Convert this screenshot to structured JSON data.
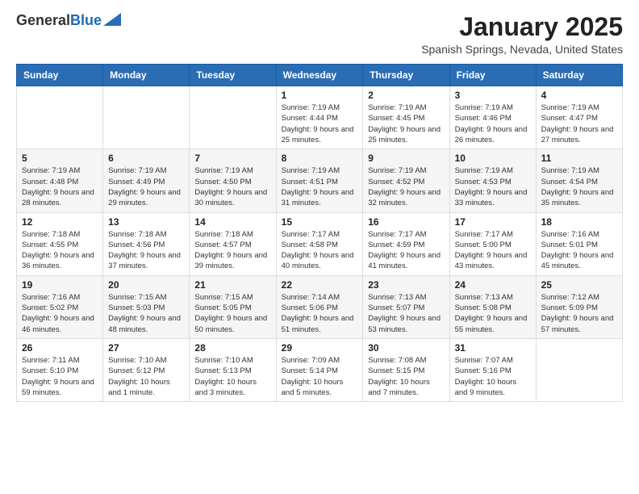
{
  "header": {
    "logo_general": "General",
    "logo_blue": "Blue",
    "month": "January 2025",
    "location": "Spanish Springs, Nevada, United States"
  },
  "weekdays": [
    "Sunday",
    "Monday",
    "Tuesday",
    "Wednesday",
    "Thursday",
    "Friday",
    "Saturday"
  ],
  "weeks": [
    [
      {
        "day": "",
        "info": ""
      },
      {
        "day": "",
        "info": ""
      },
      {
        "day": "",
        "info": ""
      },
      {
        "day": "1",
        "info": "Sunrise: 7:19 AM\nSunset: 4:44 PM\nDaylight: 9 hours and 25 minutes."
      },
      {
        "day": "2",
        "info": "Sunrise: 7:19 AM\nSunset: 4:45 PM\nDaylight: 9 hours and 25 minutes."
      },
      {
        "day": "3",
        "info": "Sunrise: 7:19 AM\nSunset: 4:46 PM\nDaylight: 9 hours and 26 minutes."
      },
      {
        "day": "4",
        "info": "Sunrise: 7:19 AM\nSunset: 4:47 PM\nDaylight: 9 hours and 27 minutes."
      }
    ],
    [
      {
        "day": "5",
        "info": "Sunrise: 7:19 AM\nSunset: 4:48 PM\nDaylight: 9 hours and 28 minutes."
      },
      {
        "day": "6",
        "info": "Sunrise: 7:19 AM\nSunset: 4:49 PM\nDaylight: 9 hours and 29 minutes."
      },
      {
        "day": "7",
        "info": "Sunrise: 7:19 AM\nSunset: 4:50 PM\nDaylight: 9 hours and 30 minutes."
      },
      {
        "day": "8",
        "info": "Sunrise: 7:19 AM\nSunset: 4:51 PM\nDaylight: 9 hours and 31 minutes."
      },
      {
        "day": "9",
        "info": "Sunrise: 7:19 AM\nSunset: 4:52 PM\nDaylight: 9 hours and 32 minutes."
      },
      {
        "day": "10",
        "info": "Sunrise: 7:19 AM\nSunset: 4:53 PM\nDaylight: 9 hours and 33 minutes."
      },
      {
        "day": "11",
        "info": "Sunrise: 7:19 AM\nSunset: 4:54 PM\nDaylight: 9 hours and 35 minutes."
      }
    ],
    [
      {
        "day": "12",
        "info": "Sunrise: 7:18 AM\nSunset: 4:55 PM\nDaylight: 9 hours and 36 minutes."
      },
      {
        "day": "13",
        "info": "Sunrise: 7:18 AM\nSunset: 4:56 PM\nDaylight: 9 hours and 37 minutes."
      },
      {
        "day": "14",
        "info": "Sunrise: 7:18 AM\nSunset: 4:57 PM\nDaylight: 9 hours and 39 minutes."
      },
      {
        "day": "15",
        "info": "Sunrise: 7:17 AM\nSunset: 4:58 PM\nDaylight: 9 hours and 40 minutes."
      },
      {
        "day": "16",
        "info": "Sunrise: 7:17 AM\nSunset: 4:59 PM\nDaylight: 9 hours and 41 minutes."
      },
      {
        "day": "17",
        "info": "Sunrise: 7:17 AM\nSunset: 5:00 PM\nDaylight: 9 hours and 43 minutes."
      },
      {
        "day": "18",
        "info": "Sunrise: 7:16 AM\nSunset: 5:01 PM\nDaylight: 9 hours and 45 minutes."
      }
    ],
    [
      {
        "day": "19",
        "info": "Sunrise: 7:16 AM\nSunset: 5:02 PM\nDaylight: 9 hours and 46 minutes."
      },
      {
        "day": "20",
        "info": "Sunrise: 7:15 AM\nSunset: 5:03 PM\nDaylight: 9 hours and 48 minutes."
      },
      {
        "day": "21",
        "info": "Sunrise: 7:15 AM\nSunset: 5:05 PM\nDaylight: 9 hours and 50 minutes."
      },
      {
        "day": "22",
        "info": "Sunrise: 7:14 AM\nSunset: 5:06 PM\nDaylight: 9 hours and 51 minutes."
      },
      {
        "day": "23",
        "info": "Sunrise: 7:13 AM\nSunset: 5:07 PM\nDaylight: 9 hours and 53 minutes."
      },
      {
        "day": "24",
        "info": "Sunrise: 7:13 AM\nSunset: 5:08 PM\nDaylight: 9 hours and 55 minutes."
      },
      {
        "day": "25",
        "info": "Sunrise: 7:12 AM\nSunset: 5:09 PM\nDaylight: 9 hours and 57 minutes."
      }
    ],
    [
      {
        "day": "26",
        "info": "Sunrise: 7:11 AM\nSunset: 5:10 PM\nDaylight: 9 hours and 59 minutes."
      },
      {
        "day": "27",
        "info": "Sunrise: 7:10 AM\nSunset: 5:12 PM\nDaylight: 10 hours and 1 minute."
      },
      {
        "day": "28",
        "info": "Sunrise: 7:10 AM\nSunset: 5:13 PM\nDaylight: 10 hours and 3 minutes."
      },
      {
        "day": "29",
        "info": "Sunrise: 7:09 AM\nSunset: 5:14 PM\nDaylight: 10 hours and 5 minutes."
      },
      {
        "day": "30",
        "info": "Sunrise: 7:08 AM\nSunset: 5:15 PM\nDaylight: 10 hours and 7 minutes."
      },
      {
        "day": "31",
        "info": "Sunrise: 7:07 AM\nSunset: 5:16 PM\nDaylight: 10 hours and 9 minutes."
      },
      {
        "day": "",
        "info": ""
      }
    ]
  ]
}
